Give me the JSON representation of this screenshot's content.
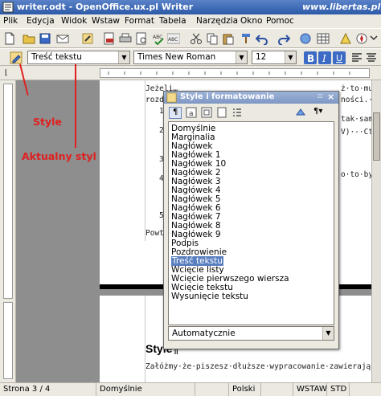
{
  "window": {
    "title": "writer.odt - OpenOffice.ux.pl Writer",
    "watermark": "www.libertas.pl"
  },
  "menu": [
    "Plik",
    "Edycja",
    "Widok",
    "Wstaw",
    "Format",
    "Tabela",
    "Narzędzia",
    "Okno",
    "Pomoc"
  ],
  "formatting": {
    "paragraph_style": "Treść tekstu",
    "font_name": "Times New Roman",
    "font_size": "12"
  },
  "annotations": {
    "style_label": "Style",
    "current_style_label": "Aktualny styl",
    "color": "#e02020"
  },
  "document": {
    "page1_lines": [
      "Jeżeli…",
      "rozd…",
      "1",
      "2",
      "3",
      "4",
      "5",
      "Powt"
    ],
    "page1_right_lines": [
      "ż·to·musisz·t",
      "ności.·¶",
      "tak·samo·,",
      "V)·-·Ctrl+",
      "o·to·by·wy"
    ],
    "heading": "Style¶",
    "body_line": "Załóżmy·że·piszesz·dłuższe·wypracowanie·zawierające·rozdz"
  },
  "styles_dialog": {
    "title": "Style i formatowanie",
    "items": [
      "Domyślnie",
      "Marginalia",
      "Nagłówek",
      "Nagłówek 1",
      "Nagłówek 10",
      "Nagłówek 2",
      "Nagłówek 3",
      "Nagłówek 4",
      "Nagłówek 5",
      "Nagłówek 6",
      "Nagłówek 7",
      "Nagłówek 8",
      "Nagłówek 9",
      "Podpis",
      "Pozdrowienie",
      "Treść tekstu",
      "Wcięcie listy",
      "Wcięcie pierwszego wiersza",
      "Wcięcie tekstu",
      "Wysunięcie tekstu"
    ],
    "selected": "Treść tekstu",
    "filter": "Automatycznie"
  },
  "status": {
    "page": "Strona 3 / 4",
    "style": "Domyślnie",
    "language": "Polski",
    "insert_mode": "WSTAW",
    "selection_mode": "STD"
  }
}
